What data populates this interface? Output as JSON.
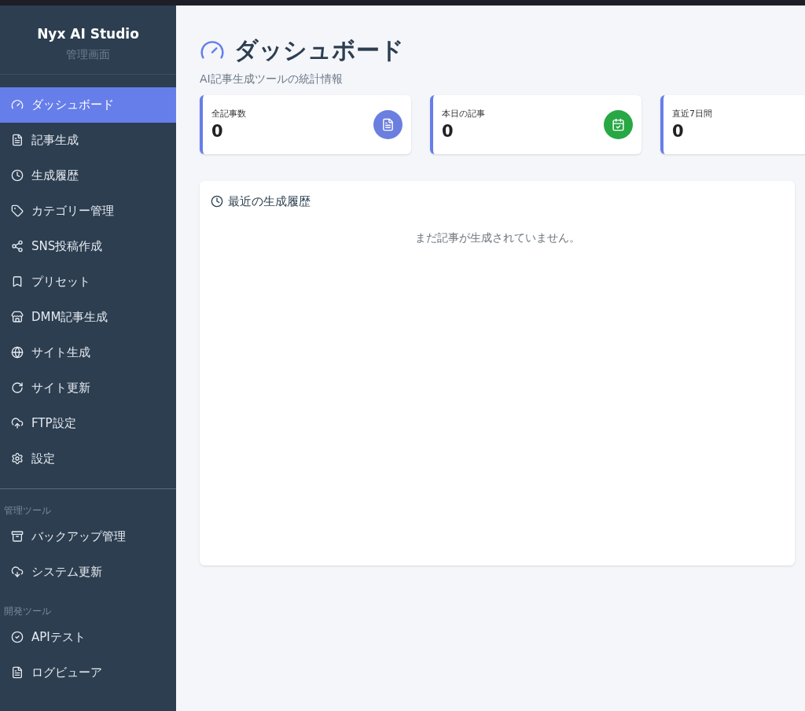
{
  "sidebar": {
    "brand": "Nyx AI Studio",
    "subtitle": "管理画面",
    "items": [
      {
        "label": "ダッシュボード",
        "selected": true
      },
      {
        "label": "記事生成",
        "selected": false
      },
      {
        "label": "生成履歴",
        "selected": false
      },
      {
        "label": "カテゴリー管理",
        "selected": false
      },
      {
        "label": "SNS投稿作成",
        "selected": false
      },
      {
        "label": "プリセット",
        "selected": false
      },
      {
        "label": "DMM記事生成",
        "selected": false
      },
      {
        "label": "サイト生成",
        "selected": false
      },
      {
        "label": "サイト更新",
        "selected": false
      },
      {
        "label": "FTP設定",
        "selected": false
      },
      {
        "label": "設定",
        "selected": false
      }
    ],
    "sections": [
      {
        "title": "管理ツール",
        "items": [
          {
            "label": "バックアップ管理",
            "selected": false
          },
          {
            "label": "システム更新",
            "selected": false
          }
        ]
      },
      {
        "title": "開発ツール",
        "items": [
          {
            "label": "APIテスト",
            "selected": false
          },
          {
            "label": "ログビューア",
            "selected": false
          }
        ]
      }
    ]
  },
  "page": {
    "title": "ダッシュボード",
    "subtitle": "AI記事生成ツールの統計情報"
  },
  "stats": [
    {
      "label": "全記事数",
      "value": "0"
    },
    {
      "label": "本日の記事",
      "value": "0"
    },
    {
      "label": "直近7日間",
      "value": "0"
    }
  ],
  "recent": {
    "title": "最近の生成履歴",
    "empty": "まだ記事が生成されていません。"
  }
}
